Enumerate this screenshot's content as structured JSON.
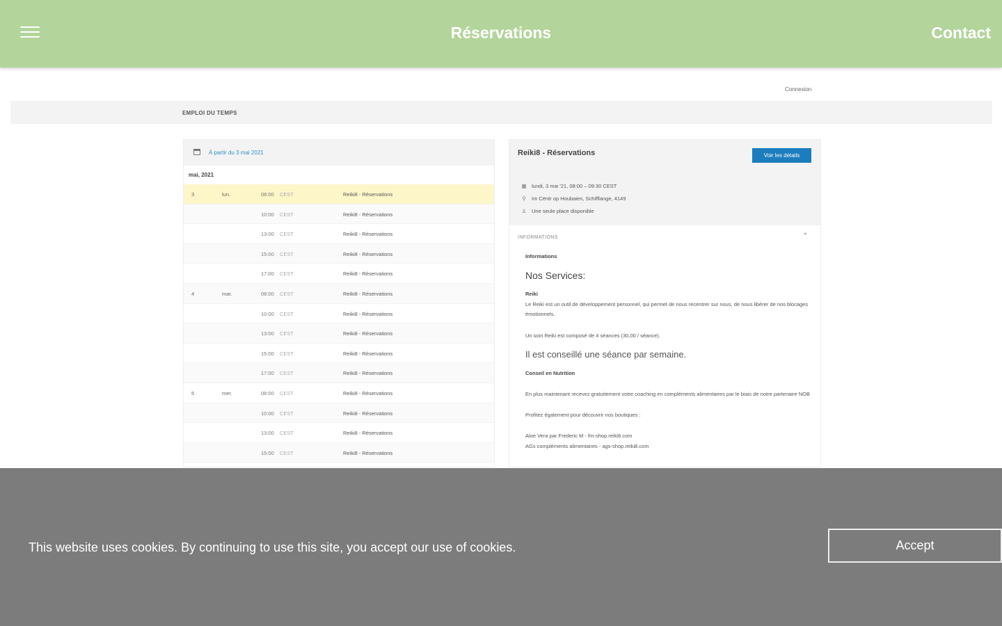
{
  "header": {
    "title": "Réservations",
    "contact": "Contact",
    "menu_icon": "hamburger-menu-icon",
    "color": "#b3d49b"
  },
  "login_link": "Connexion",
  "section_title": "EMPLOI DU TEMPS",
  "schedule": {
    "date_label": "À partir du 3 mai 2021",
    "month": "mai, 2021",
    "rows": [
      {
        "day": "3",
        "weekday": "lun.",
        "time": "08:00",
        "tz": "CEST",
        "event": "Reiki8 - Réservations"
      },
      {
        "day": "",
        "weekday": "",
        "time": "10:00",
        "tz": "CEST",
        "event": "Reiki8 - Réservations"
      },
      {
        "day": "",
        "weekday": "",
        "time": "13:00",
        "tz": "CEST",
        "event": "Reiki8 - Réservations"
      },
      {
        "day": "",
        "weekday": "",
        "time": "15:00",
        "tz": "CEST",
        "event": "Reiki8 - Réservations"
      },
      {
        "day": "",
        "weekday": "",
        "time": "17:00",
        "tz": "CEST",
        "event": "Reiki8 - Réservations"
      },
      {
        "day": "4",
        "weekday": "mar.",
        "time": "08:00",
        "tz": "CEST",
        "event": "Reiki8 - Réservations"
      },
      {
        "day": "",
        "weekday": "",
        "time": "10:00",
        "tz": "CEST",
        "event": "Reiki8 - Réservations"
      },
      {
        "day": "",
        "weekday": "",
        "time": "13:00",
        "tz": "CEST",
        "event": "Reiki8 - Réservations"
      },
      {
        "day": "",
        "weekday": "",
        "time": "15:00",
        "tz": "CEST",
        "event": "Reiki8 - Réservations"
      },
      {
        "day": "",
        "weekday": "",
        "time": "17:00",
        "tz": "CEST",
        "event": "Reiki8 - Réservations"
      },
      {
        "day": "5",
        "weekday": "mer.",
        "time": "08:00",
        "tz": "CEST",
        "event": "Reiki8 - Réservations"
      },
      {
        "day": "",
        "weekday": "",
        "time": "10:00",
        "tz": "CEST",
        "event": "Reiki8 - Réservations"
      },
      {
        "day": "",
        "weekday": "",
        "time": "13:00",
        "tz": "CEST",
        "event": "Reiki8 - Réservations"
      },
      {
        "day": "",
        "weekday": "",
        "time": "15:00",
        "tz": "CEST",
        "event": "Reiki8 - Réservations"
      }
    ]
  },
  "detail": {
    "title": "Reiki8 - Réservations",
    "details_button": "Voir les détails",
    "date_time": "lundi, 3 mai '21, 08:00 – 09:30 CEST",
    "location": "Im Cëntr op Houbaien, Schifflange, 4149",
    "availability": "Une seule place disponible",
    "accordion_label": "INFORMATIONS",
    "info_heading": "Informations",
    "services_heading": "Nos Services:",
    "reiki_label": "Reiki",
    "reiki_text": "Le Reiki est un outil de développement personnel, qui permet de nous recentrer sur nous, de nous libérer de nos blocages émotionnels.",
    "soin_text": "Un soin Reiki est composé de 4 séances (30,00 / séance).",
    "advice_text": "Il est conseillé une séance par semaine.",
    "nutrition_label": "Conseil en Nutrition",
    "nutrition_text": "En plus maintenant recevez gratuitement votre coaching en compléments alimentaires par le biais de notre partenaire NOB",
    "shop_text": "Profitez également pour découvrir nos boutiques :",
    "aloe_text": "Aloe Vera par Frederic M - fm-shop.reiki8.com",
    "ags_text": "AGs compléments alimentaires - ags-shop.reiki8.com"
  },
  "cookie": {
    "message": "This website uses cookies. By continuing to use this site, you accept our use of cookies.",
    "accept": "Accept"
  }
}
